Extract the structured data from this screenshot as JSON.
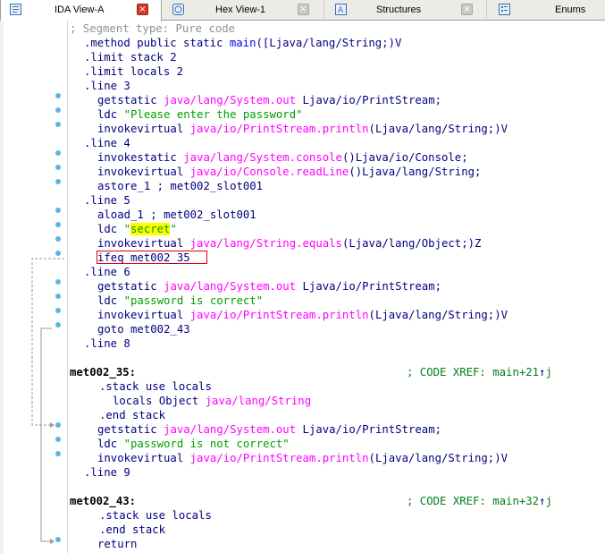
{
  "tabs": [
    {
      "label": "IDA View-A",
      "active": true,
      "icon": "ida-view-icon"
    },
    {
      "label": "Hex View-1",
      "active": false,
      "icon": "hex-view-icon"
    },
    {
      "label": "Structures",
      "active": false,
      "icon": "structures-icon"
    },
    {
      "label": "Enums",
      "active": false,
      "icon": "enums-icon"
    }
  ],
  "close_glyph": "×",
  "code": {
    "segment_comment": "; Segment type: Pure code",
    "l1": {
      "prefix": ".method public static ",
      "name": "main",
      "args": "([Ljava/lang/String;)V"
    },
    "l2": ".limit stack 2",
    "l3": ".limit locals 2",
    "l4": ".line 3",
    "l5": {
      "op": "getstatic ",
      "ref": "java/lang/System.out",
      "rest": " Ljava/io/PrintStream;"
    },
    "l6": {
      "op": "ldc ",
      "str": "\"Please enter the password\""
    },
    "l7": {
      "op": "invokevirtual ",
      "ref": "java/io/PrintStream.println",
      "rest": "(Ljava/lang/String;)V"
    },
    "l8": ".line 4",
    "l9": {
      "op": "invokestatic ",
      "ref": "java/lang/System.console",
      "rest": "()Ljava/io/Console;"
    },
    "l10": {
      "op": "invokevirtual ",
      "ref": "java/io/Console.readLine",
      "rest": "()Ljava/lang/String;"
    },
    "l11": "astore_1 ; met002_slot001",
    "l12": ".line 5",
    "l13": "aload_1 ; met002_slot001",
    "l14": {
      "op": "ldc ",
      "q1": "\"",
      "hl": "secret",
      "q2": "\""
    },
    "l15": {
      "op": "invokevirtual ",
      "ref": "java/lang/String.equals",
      "rest": "(Ljava/lang/Object;)Z"
    },
    "l16": "ifeq met002_35",
    "l17": ".line 6",
    "l18": {
      "op": "getstatic ",
      "ref": "java/lang/System.out",
      "rest": " Ljava/io/PrintStream;"
    },
    "l19": {
      "op": "ldc ",
      "str": "\"password is correct\""
    },
    "l20": {
      "op": "invokevirtual ",
      "ref": "java/io/PrintStream.println",
      "rest": "(Ljava/lang/String;)V"
    },
    "l21": "goto met002_43",
    "l22": ".line 8",
    "lbl35": "met002_35:",
    "xref35": "; CODE XREF: main+21",
    "l24": ".stack use locals",
    "l25": {
      "op": "locals Object ",
      "ref": "java/lang/String"
    },
    "l26": ".end stack",
    "l27": {
      "op": "getstatic ",
      "ref": "java/lang/System.out",
      "rest": " Ljava/io/PrintStream;"
    },
    "l28": {
      "op": "ldc ",
      "str": "\"password is not correct\""
    },
    "l29": {
      "op": "invokevirtual ",
      "ref": "java/io/PrintStream.println",
      "rest": "(Ljava/lang/String;)V"
    },
    "l30": ".line 9",
    "lbl43": "met002_43:",
    "xref43": "; CODE XREF: main+32",
    "l32": ".stack use locals",
    "l33": ".end stack",
    "l34": "return",
    "xref_suffix": "j",
    "up_arrow": "↑"
  },
  "colors": {
    "ref": "#ff00ff",
    "string": "#00a000",
    "code": "#000080",
    "xref": "#00801a",
    "gutter_dot": "#5fb4e0",
    "highlight": "#ffff00",
    "selection_box": "#e00000"
  }
}
